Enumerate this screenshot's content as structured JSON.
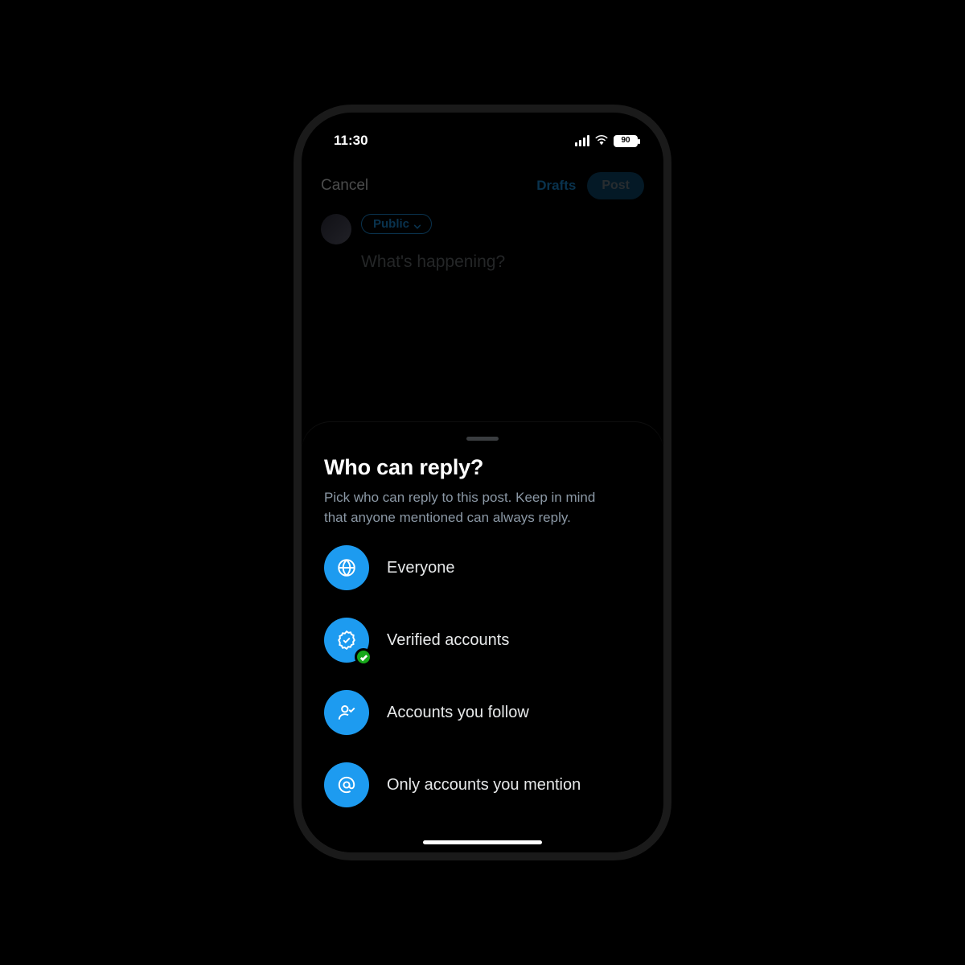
{
  "status": {
    "time": "11:30",
    "battery": "90"
  },
  "compose": {
    "cancel": "Cancel",
    "drafts": "Drafts",
    "post": "Post",
    "audience": "Public",
    "placeholder": "What's happening?"
  },
  "sheet": {
    "title": "Who can reply?",
    "description": "Pick who can reply to this post. Keep in mind that anyone mentioned can always reply.",
    "options": [
      {
        "label": "Everyone",
        "icon": "globe-icon"
      },
      {
        "label": "Verified accounts",
        "icon": "verified-icon",
        "selected": true
      },
      {
        "label": "Accounts you follow",
        "icon": "person-check-icon"
      },
      {
        "label": "Only accounts you mention",
        "icon": "mention-icon"
      }
    ]
  },
  "colors": {
    "accent": "#1d9bf0",
    "success": "#17a81a",
    "muted": "#8b98a5"
  }
}
